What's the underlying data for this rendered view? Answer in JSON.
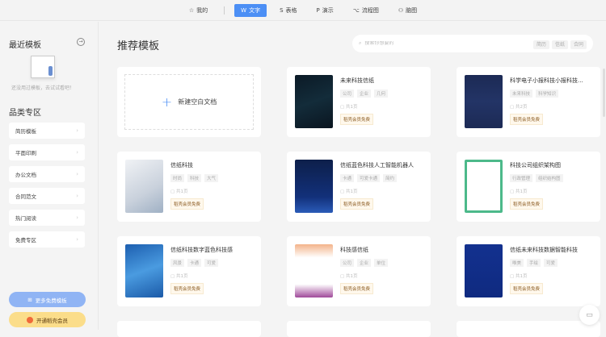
{
  "topbar": {
    "tabs": [
      {
        "icon": "star-icon",
        "glyph": "☆",
        "label": "我的"
      },
      {
        "icon": "writer-icon",
        "glyph": "W",
        "label": "文字",
        "active": true
      },
      {
        "icon": "sheet-icon",
        "glyph": "S",
        "label": "表格"
      },
      {
        "icon": "presentation-icon",
        "glyph": "P",
        "label": "演示"
      },
      {
        "icon": "flowchart-icon",
        "glyph": "⌥",
        "label": "流程图"
      },
      {
        "icon": "mindmap-icon",
        "glyph": "⚇",
        "label": "脑图"
      }
    ]
  },
  "sidebar": {
    "recent_title": "最近模板",
    "empty_text": "还没用过模板，去试试看吧！",
    "category_title": "品类专区",
    "categories": [
      "简历模板",
      "平面印刷",
      "办公文档",
      "合同范文",
      "热门阅读",
      "免费专区"
    ],
    "more_free": "更多免费模板",
    "open_vip": "开通稻壳会员"
  },
  "main": {
    "title": "推荐模板",
    "search_placeholder": "搜索你想要的",
    "search_tags": [
      "简历",
      "信纸",
      "合同"
    ],
    "new_blank": "新建空白文档",
    "cards": [
      {
        "title": "未来科技信纸",
        "tags": [
          "公司",
          "企业",
          "几何"
        ],
        "pages": "共1页",
        "badge": "稻壳会员免费",
        "bg": "linear-gradient(160deg,#0b1a26,#132c3a 50%,#0a1520)"
      },
      {
        "title": "科学电子小报科技小报科技...",
        "tags": [
          "未来科技",
          "科学知识"
        ],
        "pages": "共2页",
        "badge": "稻壳会员免费",
        "bg": "linear-gradient(#1c2a55,#233466 50%,#1c2a55)"
      },
      {
        "title": "信纸科技",
        "tags": [
          "时尚",
          "科技",
          "大气"
        ],
        "pages": "共1页",
        "badge": "稻壳会员免费",
        "bg": "linear-gradient(150deg,#f0f2f5,#c9d1dc 60%,#9fb0c4)"
      },
      {
        "title": "信纸蓝色科技人工智能机器人",
        "tags": [
          "卡通",
          "可爱卡通",
          "简约"
        ],
        "pages": "共1页",
        "badge": "稻壳会员免费",
        "bg": "linear-gradient(#0d1f4a,#12307a 70%,#2a5bb8)"
      },
      {
        "title": "科技公司组织架构图",
        "tags": [
          "行政管理",
          "组织结构图"
        ],
        "pages": "共1页",
        "badge": "稻壳会员免费",
        "bg": "linear-gradient(#fff,#fff) padding-box,#4cb98a"
      },
      {
        "title": "信纸科技数字蓝色科技感",
        "tags": [
          "风景",
          "卡通",
          "可爱"
        ],
        "pages": "共1页",
        "badge": "稻壳会员免费",
        "bg": "linear-gradient(160deg,#1d5fb0,#4a9be0 50%,#1b5aa8)"
      },
      {
        "title": "科技感信纸",
        "tags": [
          "公司",
          "企业",
          "单位"
        ],
        "pages": "共1页",
        "badge": "稻壳会员免费",
        "bg": "linear-gradient(#f3b38a,#fff 25%,#fff 75%,#a04a9a)"
      },
      {
        "title": "信纸未来科技数据智能科技",
        "tags": [
          "唯美",
          "手绘",
          "可爱"
        ],
        "pages": "共1页",
        "badge": "稻壳会员免费",
        "bg": "linear-gradient(#13318f,#0f2a80)"
      }
    ]
  }
}
